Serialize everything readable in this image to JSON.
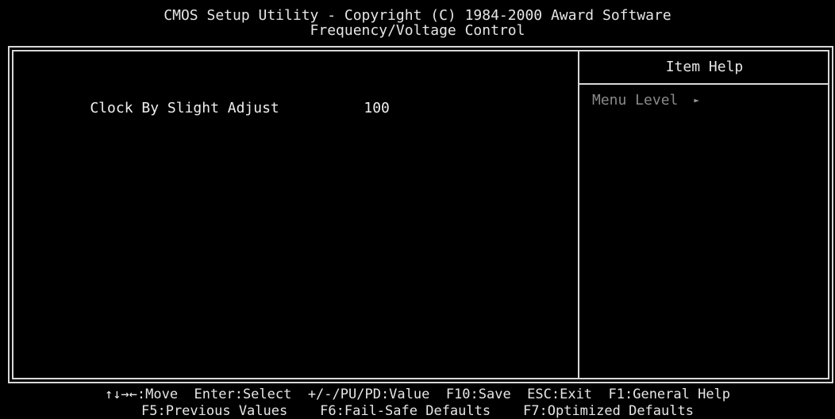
{
  "header": {
    "title": "CMOS Setup Utility - Copyright (C) 1984-2000 Award Software",
    "subtitle": "Frequency/Voltage Control"
  },
  "main": {
    "items": [
      {
        "label": "Clock By Slight Adjust",
        "value": "100"
      }
    ]
  },
  "help_panel": {
    "title": "Item Help",
    "menu_level_label": "Menu Level",
    "menu_level_indicator": "►"
  },
  "footer": {
    "line1": "↑↓→←:Move  Enter:Select  +/-/PU/PD:Value  F10:Save  ESC:Exit  F1:General Help",
    "line2": "F5:Previous Values    F6:Fail-Safe Defaults    F7:Optimized Defaults"
  },
  "colors": {
    "background": "#000000",
    "text": "#e8e8e8",
    "help_text": "#8a8a8a",
    "frame": "#d8d8d8"
  }
}
